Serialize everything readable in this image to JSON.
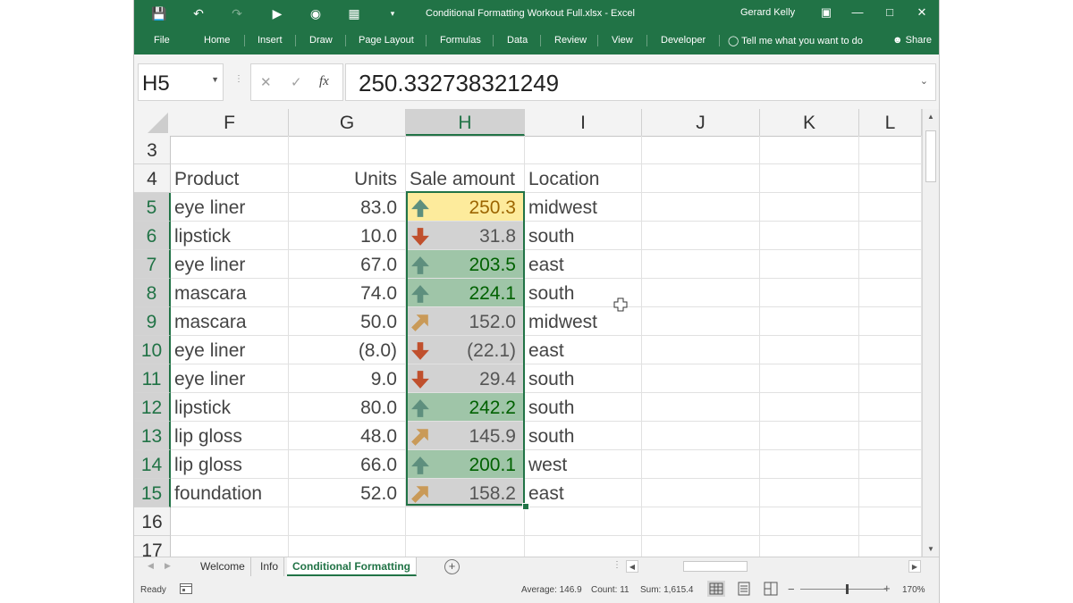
{
  "window": {
    "title": "Conditional Formatting Workout Full.xlsx  -  Excel",
    "user": "Gerard Kelly",
    "accent": "#217346"
  },
  "qat": {
    "icons": [
      "save-icon",
      "undo-icon",
      "redo-icon",
      "touch-mode-icon",
      "camera-icon",
      "calculator-icon",
      "customize-qat-icon"
    ]
  },
  "ribbon": {
    "tabs": [
      "File",
      "Home",
      "Insert",
      "Draw",
      "Page Layout",
      "Formulas",
      "Data",
      "Review",
      "View",
      "Developer"
    ],
    "tell_me": "Tell me what you want to do",
    "share": "Share"
  },
  "formula_bar": {
    "name_box": "H5",
    "fx": "fx",
    "value": "250.332738321249"
  },
  "grid": {
    "columns": [
      "F",
      "G",
      "H",
      "I",
      "J",
      "K",
      "L"
    ],
    "selected_column": "H",
    "rows": [
      {
        "num": "3",
        "product": "",
        "units": "",
        "sale": "",
        "location": "",
        "arrow": "",
        "fill": ""
      },
      {
        "num": "4",
        "product": "Product",
        "units": "Units",
        "sale": "Sale amount",
        "location": "Location",
        "arrow": "",
        "fill": ""
      },
      {
        "num": "5",
        "product": "eye liner",
        "units": "83.0",
        "sale": "250.3",
        "location": "midwest",
        "arrow": "up",
        "fill": "yellow"
      },
      {
        "num": "6",
        "product": "lipstick",
        "units": "10.0",
        "sale": "31.8",
        "location": "south",
        "arrow": "down",
        "fill": "gray"
      },
      {
        "num": "7",
        "product": "eye liner",
        "units": "67.0",
        "sale": "203.5",
        "location": "east",
        "arrow": "up",
        "fill": "green"
      },
      {
        "num": "8",
        "product": "mascara",
        "units": "74.0",
        "sale": "224.1",
        "location": "south",
        "arrow": "up",
        "fill": "green"
      },
      {
        "num": "9",
        "product": "mascara",
        "units": "50.0",
        "sale": "152.0",
        "location": "midwest",
        "arrow": "diag",
        "fill": "gray"
      },
      {
        "num": "10",
        "product": "eye liner",
        "units": "(8.0)",
        "sale": "(22.1)",
        "location": "east",
        "arrow": "down",
        "fill": "gray"
      },
      {
        "num": "11",
        "product": "eye liner",
        "units": "9.0",
        "sale": "29.4",
        "location": "south",
        "arrow": "down",
        "fill": "gray"
      },
      {
        "num": "12",
        "product": "lipstick",
        "units": "80.0",
        "sale": "242.2",
        "location": "south",
        "arrow": "up",
        "fill": "green"
      },
      {
        "num": "13",
        "product": "lip gloss",
        "units": "48.0",
        "sale": "145.9",
        "location": "south",
        "arrow": "diag",
        "fill": "gray"
      },
      {
        "num": "14",
        "product": "lip gloss",
        "units": "66.0",
        "sale": "200.1",
        "location": "west",
        "arrow": "up",
        "fill": "green"
      },
      {
        "num": "15",
        "product": "foundation",
        "units": "52.0",
        "sale": "158.2",
        "location": "east",
        "arrow": "diag",
        "fill": "gray"
      },
      {
        "num": "16",
        "product": "",
        "units": "",
        "sale": "",
        "location": "",
        "arrow": "",
        "fill": ""
      },
      {
        "num": "17",
        "product": "",
        "units": "",
        "sale": "",
        "location": "",
        "arrow": "",
        "fill": ""
      }
    ],
    "fill_colors": {
      "yellow": "#fdeb9c",
      "green": "#9fc5a8",
      "gray": "#d2d2d2"
    },
    "text_colors": {
      "yellow": "#9c6500",
      "green": "#006100",
      "gray": "#555555"
    },
    "arrow_colors": {
      "up": "#5e8f7e",
      "down": "#c0502d",
      "diag": "#c99a58"
    }
  },
  "sheets": {
    "tabs": [
      "Welcome",
      "Info",
      "Conditional Formatting"
    ],
    "active": "Conditional Formatting"
  },
  "status": {
    "ready": "Ready",
    "average": "Average: 146.9",
    "count": "Count: 11",
    "sum": "Sum: 1,615.4",
    "zoom": "170%"
  }
}
